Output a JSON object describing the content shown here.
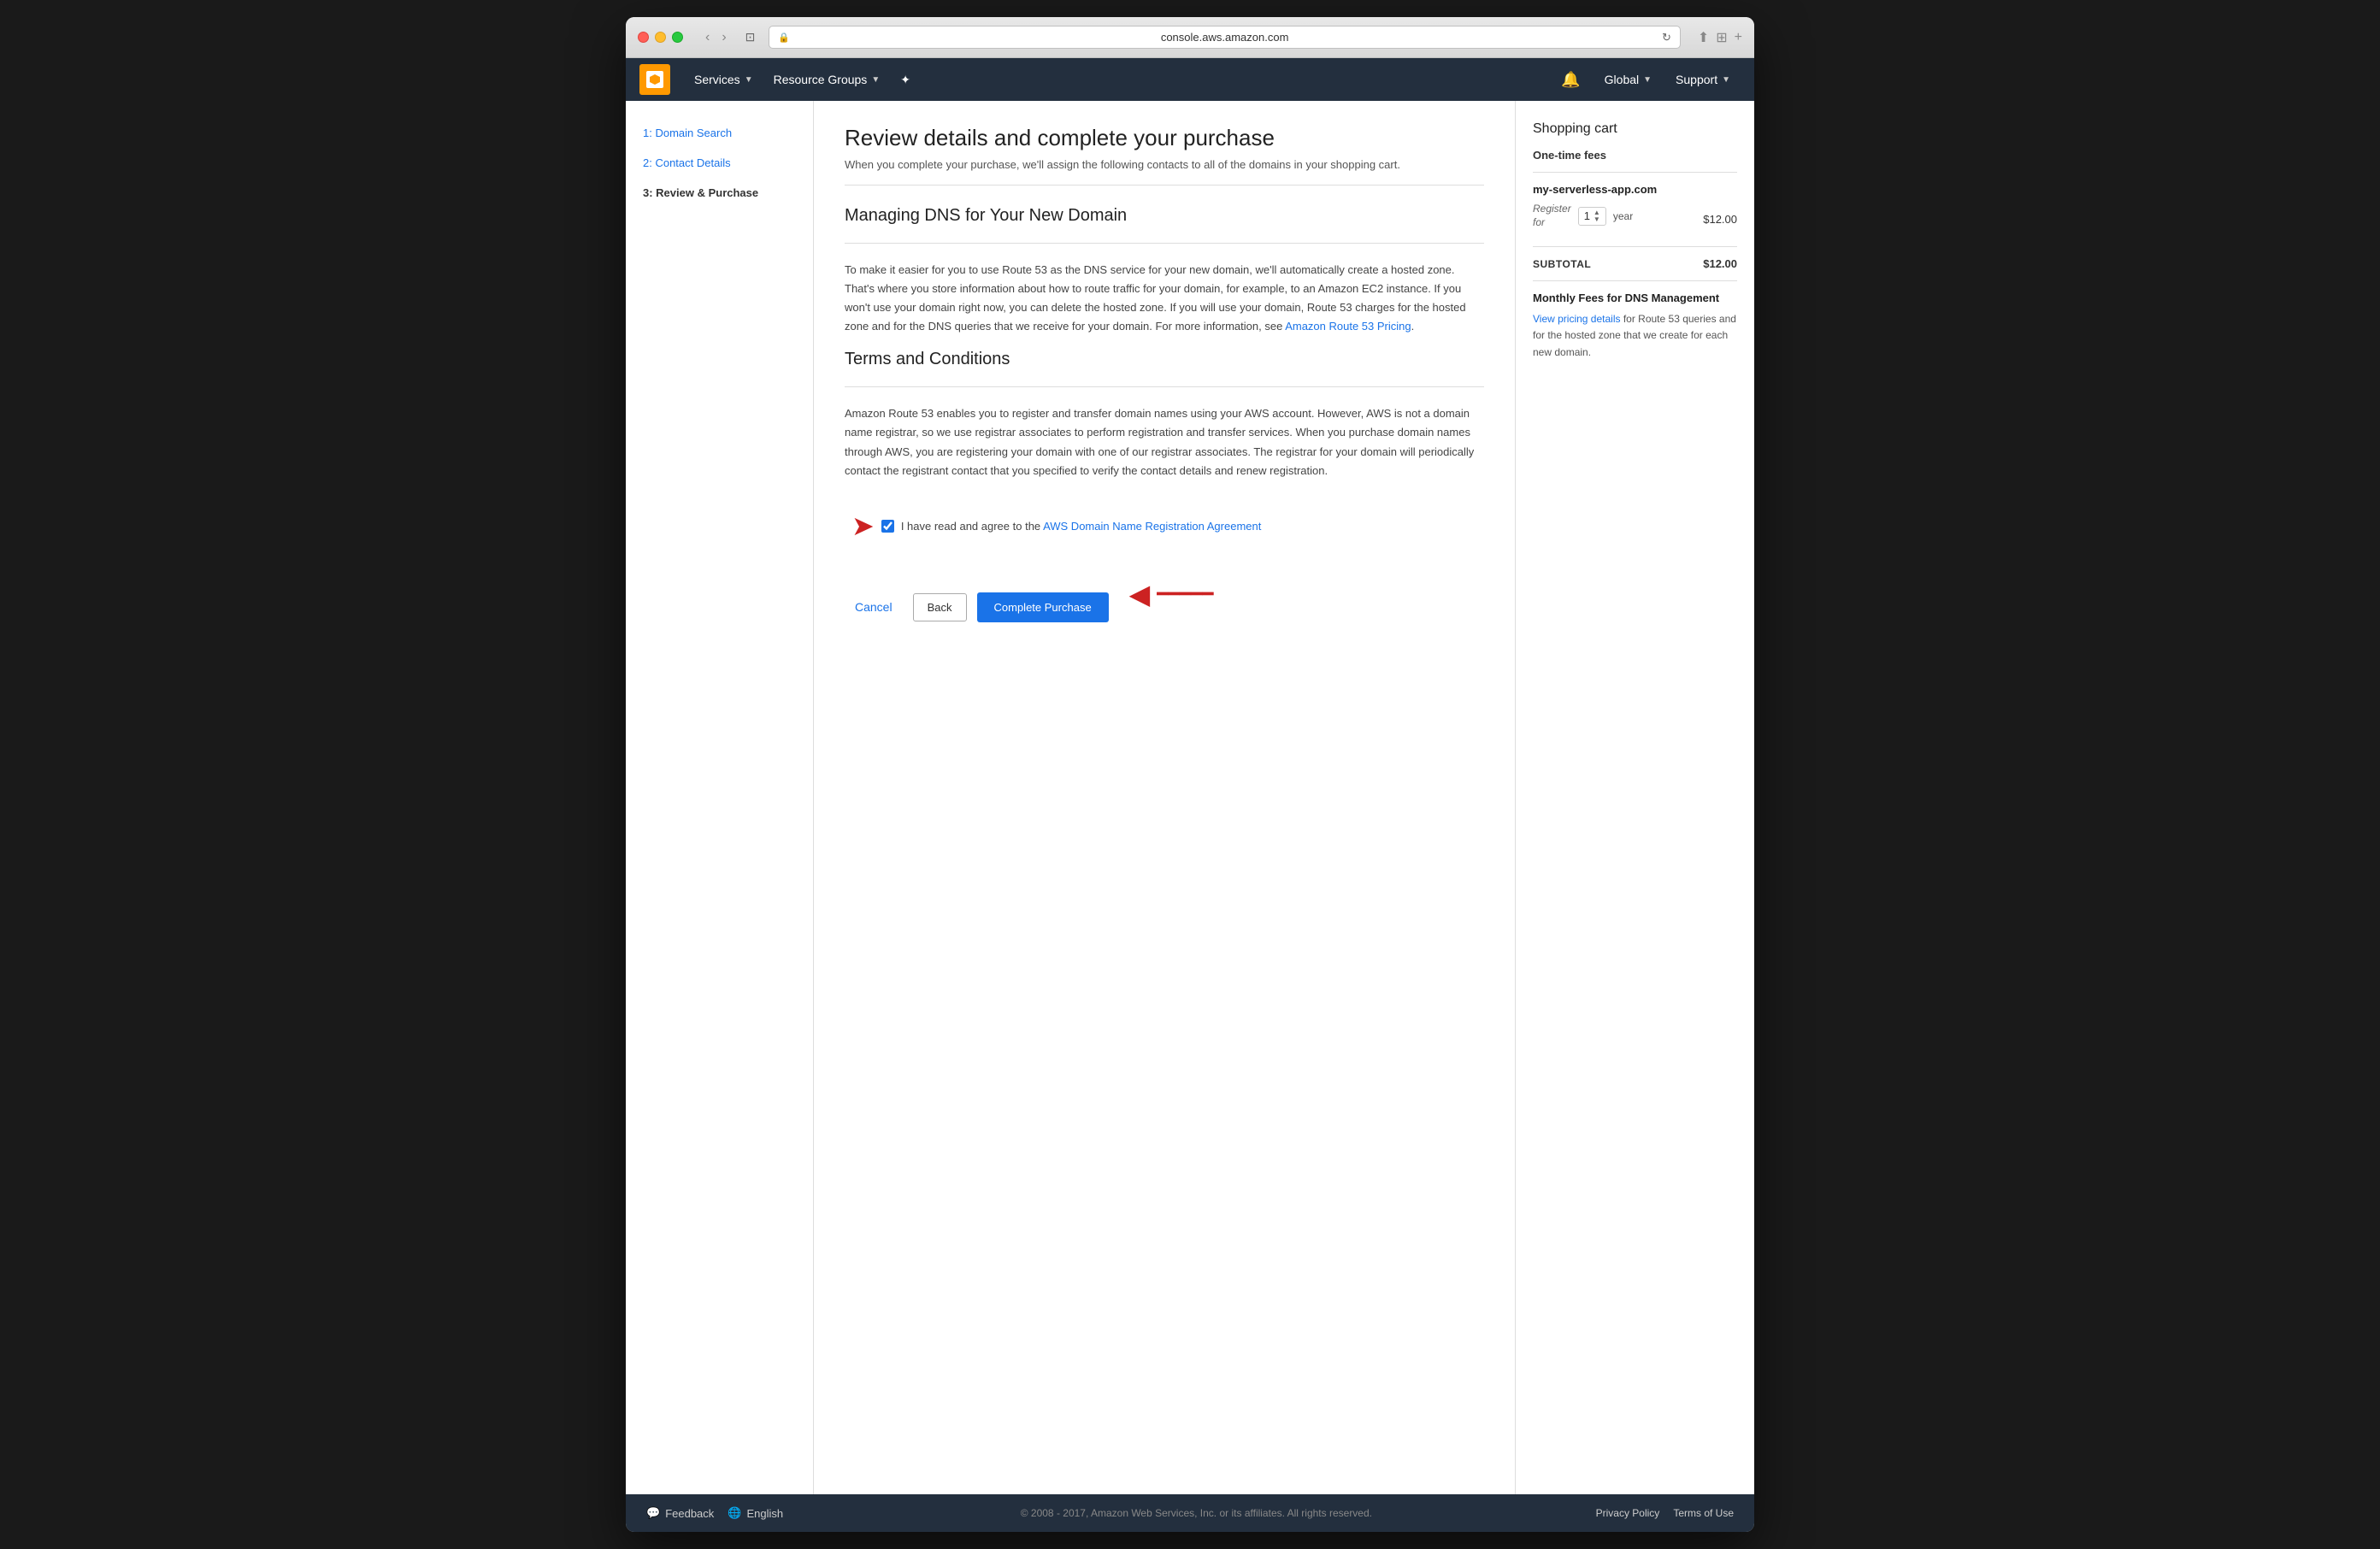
{
  "browser": {
    "url": "console.aws.amazon.com",
    "tab_icon": "🔲"
  },
  "navbar": {
    "services_label": "Services",
    "resource_groups_label": "Resource Groups",
    "global_label": "Global",
    "support_label": "Support"
  },
  "sidebar": {
    "items": [
      {
        "label": "1: Domain Search",
        "type": "link",
        "active": false
      },
      {
        "label": "2: Contact Details",
        "type": "link",
        "active": false
      },
      {
        "label": "3: Review & Purchase",
        "type": "active",
        "active": true
      }
    ]
  },
  "main": {
    "page_title": "Review details and complete your purchase",
    "subtitle": "When you complete your purchase, we'll assign the following contacts to all of the domains in your shopping cart.",
    "dns_section_title": "Managing DNS for Your New Domain",
    "dns_body": "To make it easier for you to use Route 53 as the DNS service for your new domain, we'll automatically create a hosted zone. That's where you store information about how to route traffic for your domain, for example, to an Amazon EC2 instance. If you won't use your domain right now, you can delete the hosted zone. If you will use your domain, Route 53 charges for the hosted zone and for the DNS queries that we receive for your domain. For more information, see ",
    "dns_link_text": "Amazon Route 53 Pricing",
    "terms_section_title": "Terms and Conditions",
    "terms_body": "Amazon Route 53 enables you to register and transfer domain names using your AWS account. However, AWS is not a domain name registrar, so we use registrar associates to perform registration and transfer services. When you purchase domain names through AWS, you are registering your domain with one of our registrar associates. The registrar for your domain will periodically contact the registrant contact that you specified to verify the contact details and renew registration.",
    "checkbox_label": "I have read and agree to the ",
    "agreement_link": "AWS Domain Name Registration Agreement",
    "cancel_label": "Cancel",
    "back_label": "Back",
    "complete_label": "Complete Purchase"
  },
  "cart": {
    "title": "Shopping cart",
    "one_time_fees": "One-time fees",
    "domain_name": "my-serverless-app.com",
    "register_label": "Register\nfor",
    "years": "1",
    "year_label": "year",
    "price": "$12.00",
    "subtotal_label": "SUBTOTAL",
    "subtotal_price": "$12.00",
    "monthly_fees_title": "Monthly Fees for DNS Management",
    "view_pricing_label": "View pricing details",
    "monthly_fees_text": " for Route 53 queries and for the hosted zone that we create for each new domain."
  },
  "footer": {
    "feedback_label": "Feedback",
    "english_label": "English",
    "copyright": "© 2008 - 2017, Amazon Web Services, Inc. or its affiliates. All rights reserved.",
    "privacy_policy": "Privacy Policy",
    "terms_of_use": "Terms of Use"
  }
}
